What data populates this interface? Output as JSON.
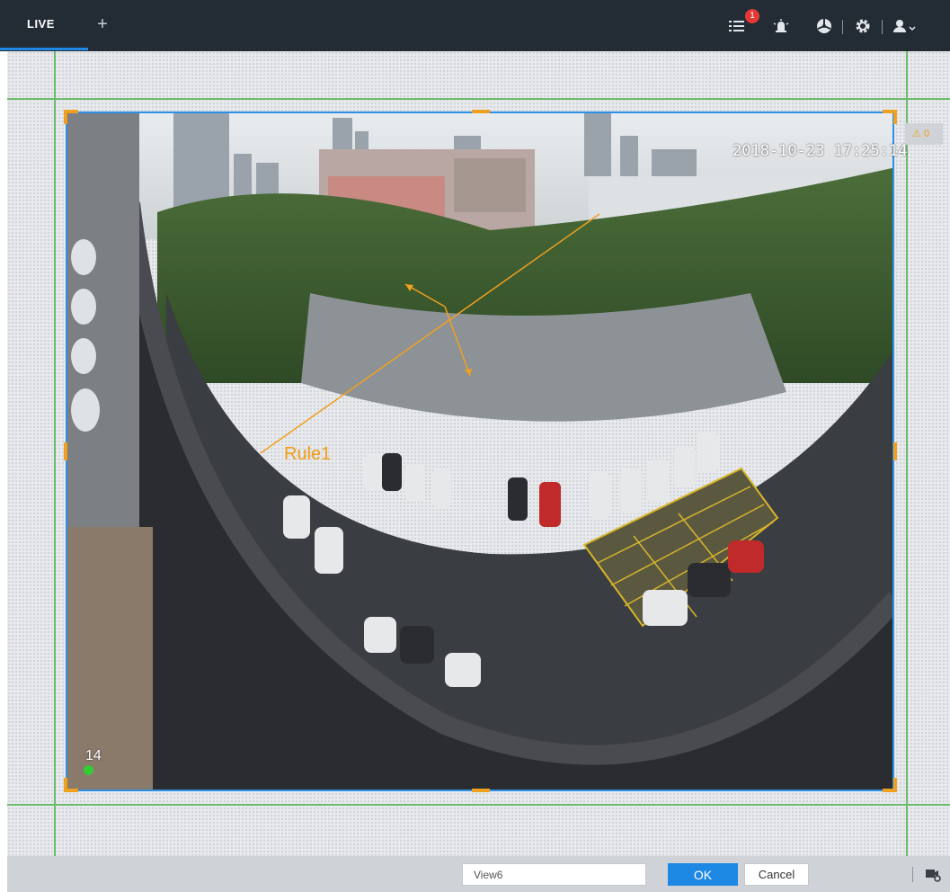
{
  "topbar": {
    "tab_live": "LIVE",
    "tab_add": "+",
    "notification_count": "1",
    "icons": [
      "event-list-icon",
      "alarm-light-icon",
      "fan-icon",
      "gear-icon",
      "user-icon"
    ]
  },
  "video": {
    "timestamp": "2018-10-23 17:25:14",
    "rule_label": "Rule1",
    "channel_number": "14"
  },
  "alarm_chip": {
    "count": "0",
    "icon": "warning-icon"
  },
  "bottombar": {
    "view_name_value": "View6",
    "ok_label": "OK",
    "cancel_label": "Cancel",
    "layout_icon": "window-settings-icon"
  },
  "colors": {
    "topbar_bg": "#232b35",
    "accent_blue": "#1e88e5",
    "rule_orange": "#f39c12",
    "grid_green": "#6cbb6c"
  }
}
